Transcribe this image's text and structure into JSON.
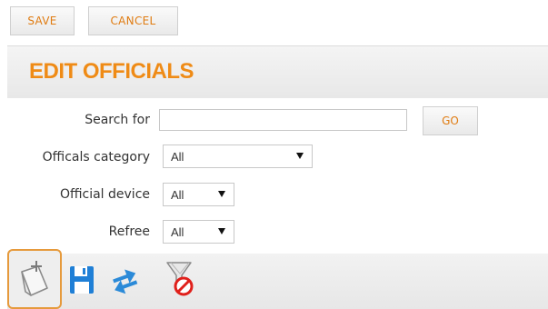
{
  "toolbar_top": {
    "save_label": "SAVE",
    "cancel_label": "CANCEL"
  },
  "panel": {
    "title": "EDIT OFFICIALS"
  },
  "filters": {
    "search_label": "Search for",
    "search_value": "",
    "go_label": "GO",
    "category_label": "Officals category",
    "category_value": "All",
    "device_label": "Official device",
    "device_value": "All",
    "referee_label": "Refree",
    "referee_value": "All"
  },
  "actions": {
    "icons": [
      "add-document-icon",
      "save-disk-icon",
      "refresh-arrows-icon",
      "clear-filter-icon"
    ]
  },
  "colors": {
    "accent": "#ef8b16",
    "button_text": "#e07c12",
    "selected_outline": "#e69a3c",
    "disk_blue": "#1f7fd6",
    "arrows_blue": "#2b8ad8",
    "no_sign_red": "#e0201b"
  }
}
